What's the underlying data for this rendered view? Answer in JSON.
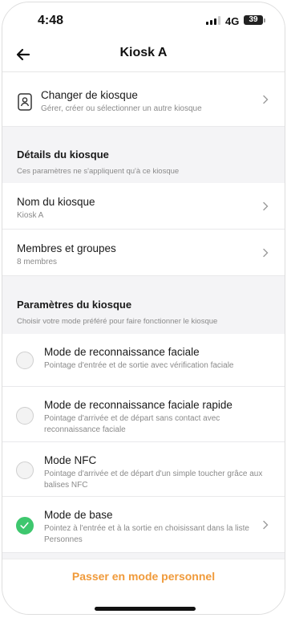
{
  "status_bar": {
    "time": "4:48",
    "network": "4G",
    "battery": "39"
  },
  "header": {
    "title": "Kiosk A",
    "back_icon": "arrow-left-icon"
  },
  "change_kiosk": {
    "title": "Changer de kiosque",
    "subtitle": "Gérer, créer ou sélectionner un autre kiosque",
    "icon": "kiosk-user-icon"
  },
  "kiosk_details": {
    "title": "Détails du kiosque",
    "subtitle": "Ces paramètres ne s'appliquent qu'à ce kiosque",
    "items": [
      {
        "title": "Nom du kiosque",
        "value": "Kiosk A"
      },
      {
        "title": "Membres et groupes",
        "value": "8 membres"
      }
    ]
  },
  "kiosk_settings": {
    "title": "Paramètres du kiosque",
    "subtitle": "Choisir votre mode préféré pour faire fonctionner le kiosque",
    "modes": [
      {
        "title": "Mode de reconnaissance faciale",
        "description": "Pointage d'entrée et de sortie avec vérification faciale",
        "selected": false
      },
      {
        "title": "Mode de reconnaissance faciale rapide",
        "description": "Pointage d'arrivée et de départ sans contact avec reconnaissance faciale",
        "selected": false
      },
      {
        "title": "Mode NFC",
        "description": "Pointage d'arrivée et de départ d'un simple toucher grâce aux balises NFC",
        "selected": false
      },
      {
        "title": "Mode de base",
        "description": "Pointez à l'entrée et à la sortie en choisissant dans la liste Personnes",
        "selected": true
      }
    ]
  },
  "footer": {
    "button_label": "Passer en mode personnel"
  },
  "colors": {
    "accent_orange": "#f09a3a",
    "selected_green": "#3ec76e",
    "background": "#f4f4f6"
  }
}
